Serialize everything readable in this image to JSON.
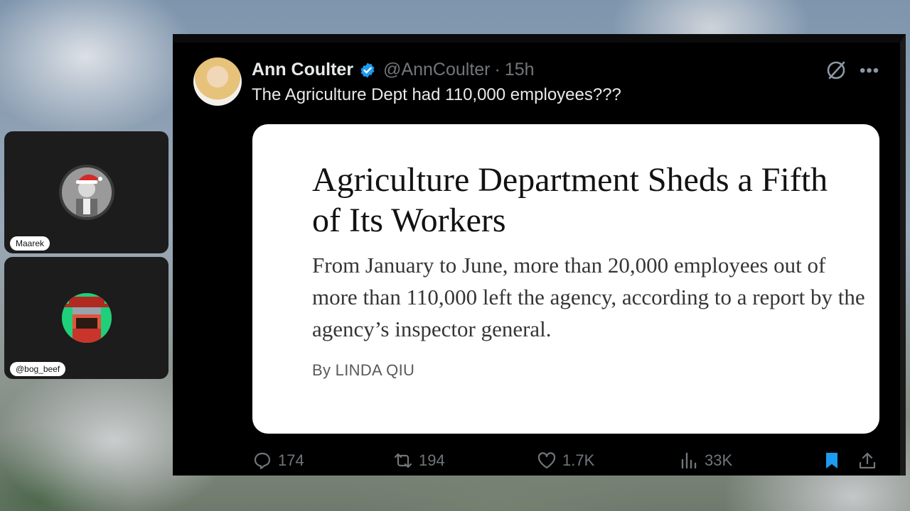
{
  "participants": [
    {
      "label": "Maarek",
      "avatar_icon": "santa-hat-avatar-icon"
    },
    {
      "label": "@bog_beef",
      "avatar_icon": "pixel-cowboy-avatar-icon"
    }
  ],
  "tweet": {
    "author_name": "Ann Coulter",
    "handle": "@AnnCoulter",
    "separator": "·",
    "time": "15h",
    "text": "The Agriculture Dept had 110,000 employees???",
    "verified_color": "#1d9bf0",
    "card": {
      "headline": "Agriculture Department Sheds a Fifth of Its Workers",
      "summary": "From January to June, more than 20,000 employees out of more than 110,000 left the agency, according to a report by the agency’s inspector general.",
      "byline": "By LINDA QIU"
    },
    "actions": {
      "replies": "174",
      "reposts": "194",
      "likes": "1.7K",
      "views": "33K"
    },
    "bookmark_color": "#1d9bf0"
  }
}
